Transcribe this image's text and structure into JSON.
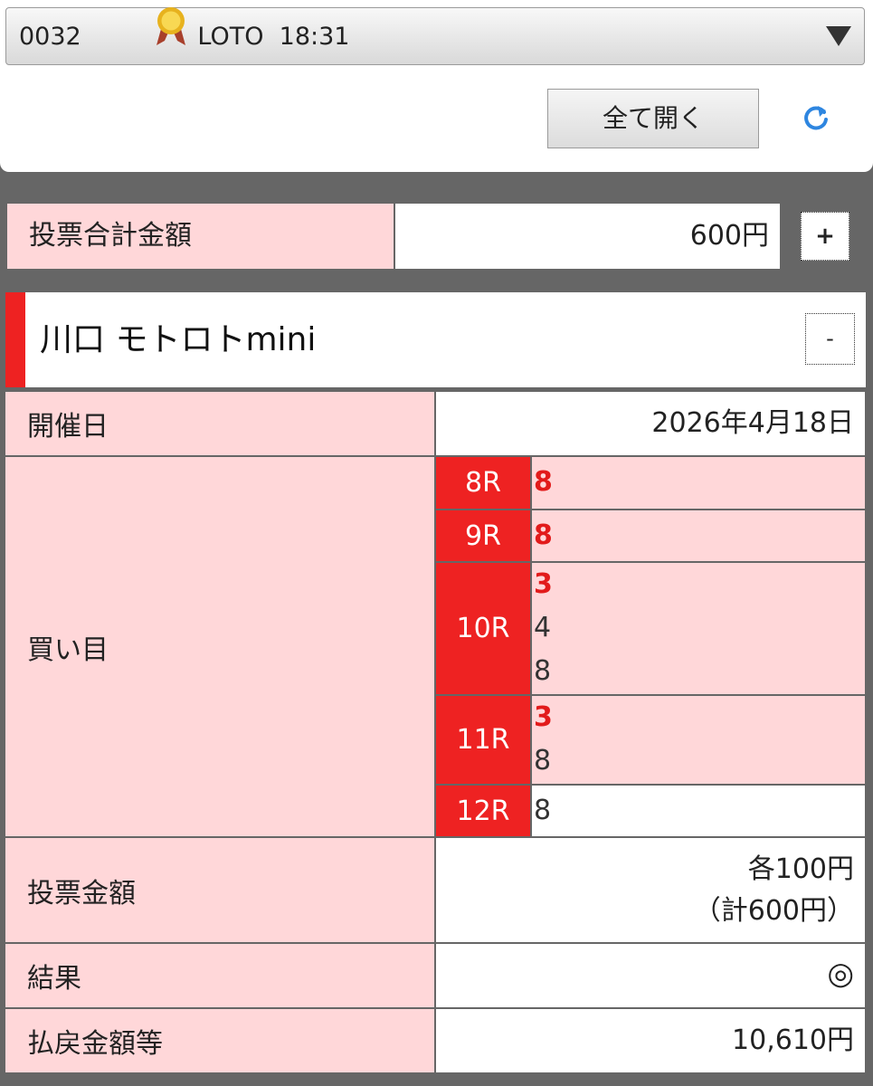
{
  "header": {
    "id": "0032",
    "name": "LOTO",
    "time": "18:31",
    "open_all_label": "全て開く",
    "medal_icon": "gold-medal-icon",
    "refresh_icon": "refresh-icon",
    "dropdown_icon": "triangle-down-icon"
  },
  "summary": {
    "total_label": "投票合計金額",
    "total_value": "600円",
    "expand_label": "+"
  },
  "race": {
    "title": "川口 モトロトmini",
    "collapse_label": "-",
    "date_label": "開催日",
    "date_value": "2026年4月18日",
    "picks_label": "買い目",
    "picks": [
      {
        "race": "8R",
        "numbers": [
          {
            "n": "8",
            "hit": true
          }
        ]
      },
      {
        "race": "9R",
        "numbers": [
          {
            "n": "8",
            "hit": true
          }
        ]
      },
      {
        "race": "10R",
        "numbers": [
          {
            "n": "3",
            "hit": true
          },
          {
            "n": "4",
            "hit": false
          },
          {
            "n": "8",
            "hit": false
          }
        ]
      },
      {
        "race": "11R",
        "numbers": [
          {
            "n": "3",
            "hit": true
          },
          {
            "n": "8",
            "hit": false
          }
        ]
      },
      {
        "race": "12R",
        "numbers": [
          {
            "n": "8",
            "hit": false
          }
        ]
      }
    ],
    "bet_label": "投票金額",
    "bet_each": "各100円",
    "bet_total": "（計600円）",
    "result_label": "結果",
    "result_value": "◎",
    "payout_label": "払戻金額等",
    "payout_value": "10,610円"
  },
  "colors": {
    "accent_red": "#ee2222",
    "pink_bg": "#ffd7d9",
    "hit_text": "#e21b1b",
    "frame_gray": "#666666"
  }
}
